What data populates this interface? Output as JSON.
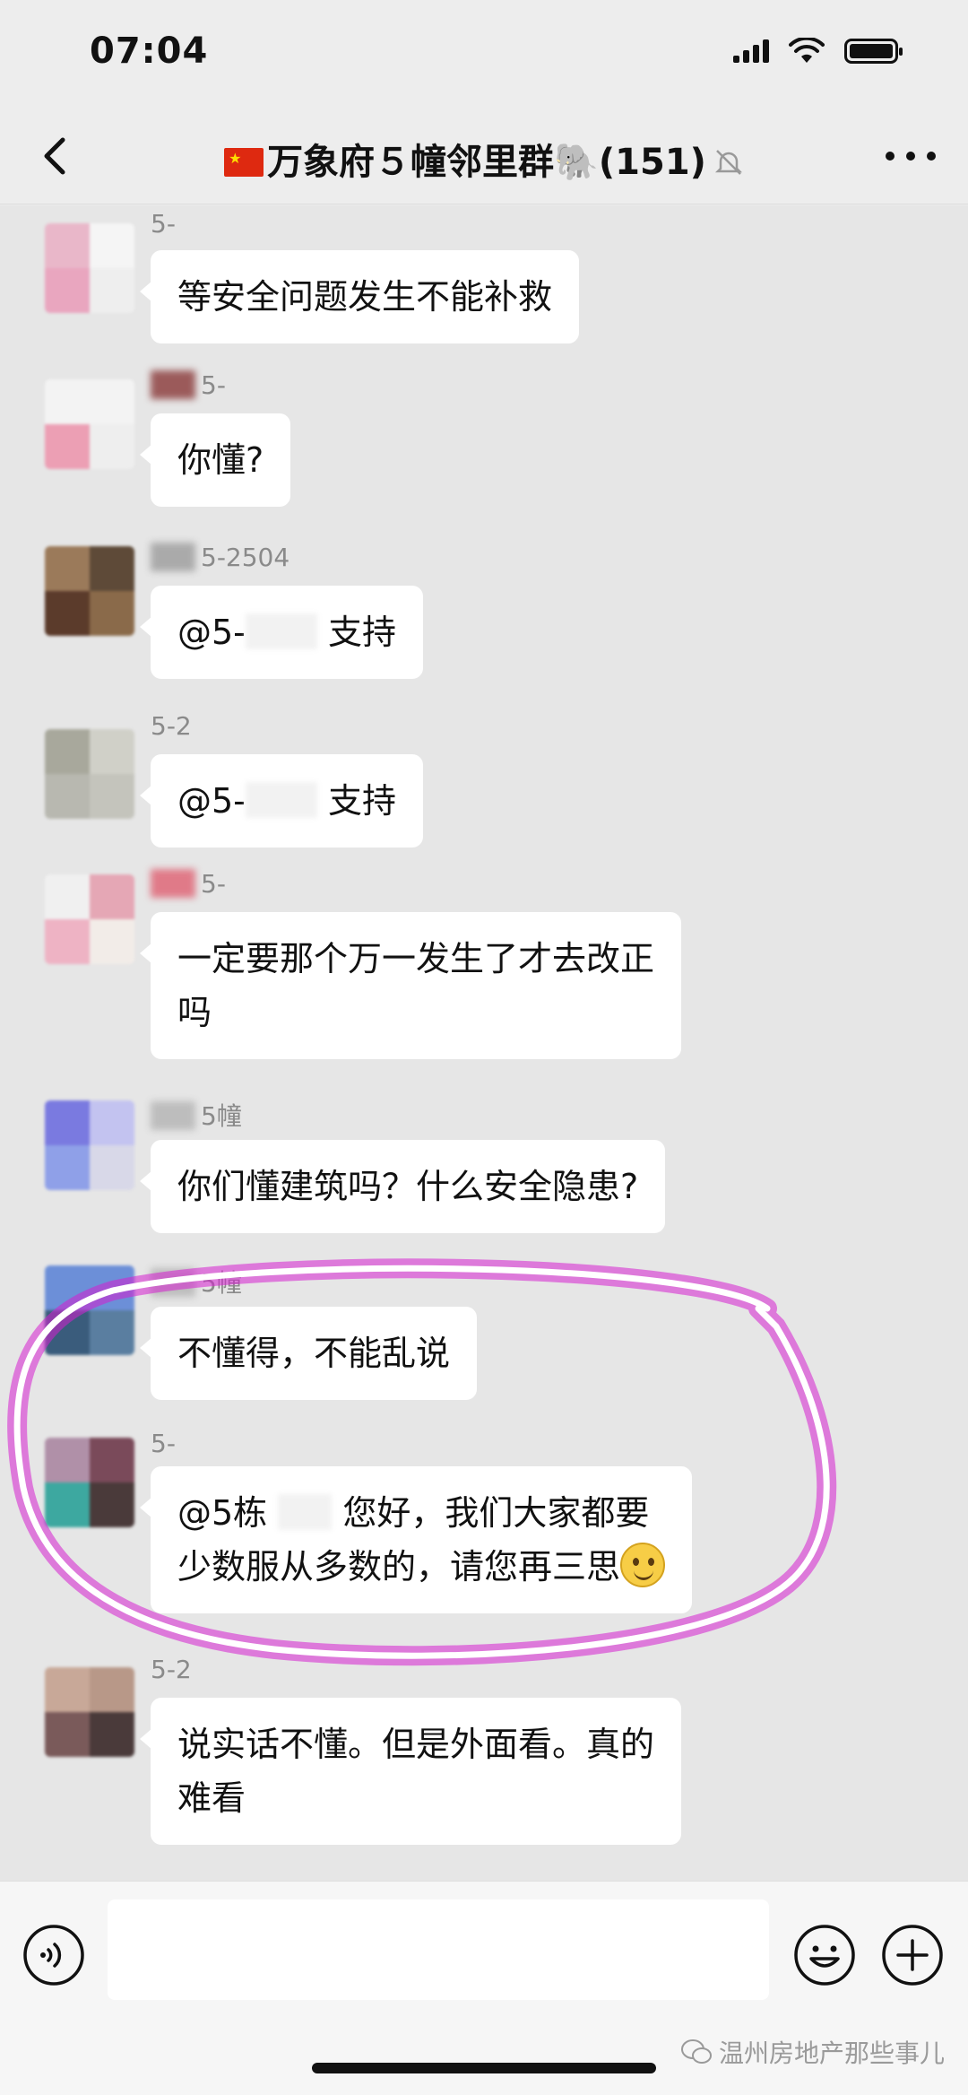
{
  "status_bar": {
    "time": "07:04"
  },
  "header": {
    "title": "万象府５幢邻里群",
    "member_count": "(151)"
  },
  "messages": [
    {
      "sender": "5-",
      "text": "等安全问题发生不能补救"
    },
    {
      "sender": "5-",
      "text": "你懂?"
    },
    {
      "sender": "5-2504",
      "mention": "@5-",
      "text": "支持"
    },
    {
      "sender": "5-2",
      "mention": "@5-",
      "text": "支持"
    },
    {
      "sender": "5-",
      "text_line1": "一定要那个万一发生了才去改正",
      "text_line2": "吗"
    },
    {
      "sender": "5幢",
      "text": "你们懂建筑吗？什么安全隐患?"
    },
    {
      "sender": "5幢",
      "text": "不懂得，不能乱说"
    },
    {
      "sender": "5-",
      "mention": "@5栋",
      "text_line1": "您好，我们大家都要",
      "text_line2": "少数服从多数的，请您再三思"
    },
    {
      "sender": "5-2",
      "text_line1": "说实话不懂。但是外面看。真的",
      "text_line2": "难看"
    }
  ],
  "watermark": "温州房地产那些事儿",
  "colors": {
    "bubble": "#ffffff",
    "background": "#e6e6e6",
    "annotation": "#d61fd0"
  },
  "icons": [
    "back-icon",
    "more-icon",
    "mute-icon",
    "voice-icon",
    "emoji-icon",
    "plus-icon"
  ]
}
